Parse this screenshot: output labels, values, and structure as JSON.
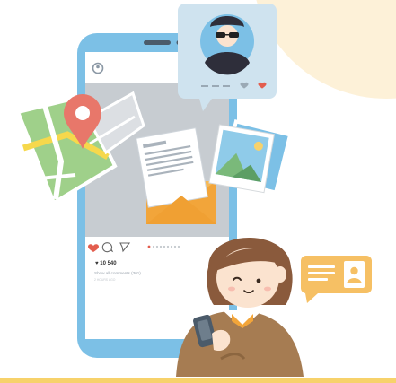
{
  "post": {
    "likes_text": "♥ 10 540",
    "comments_text": "Show all comments (301)",
    "time_text": "2 HOURS AGO"
  },
  "colors": {
    "phone_frame": "#7cc0e6",
    "screen": "#e9ecef",
    "accent_red": "#e35d4e",
    "envelope": "#f2a53a",
    "sun": "#fdf1d8",
    "ground_line": "#f7d26b",
    "skin": "#fbe3cf",
    "hair": "#8a5a3c",
    "jacket": "#a67c52"
  },
  "icons": [
    "heart-icon",
    "comment-icon",
    "share-icon",
    "profile-icon",
    "location-pin-icon",
    "contact-card-icon"
  ]
}
